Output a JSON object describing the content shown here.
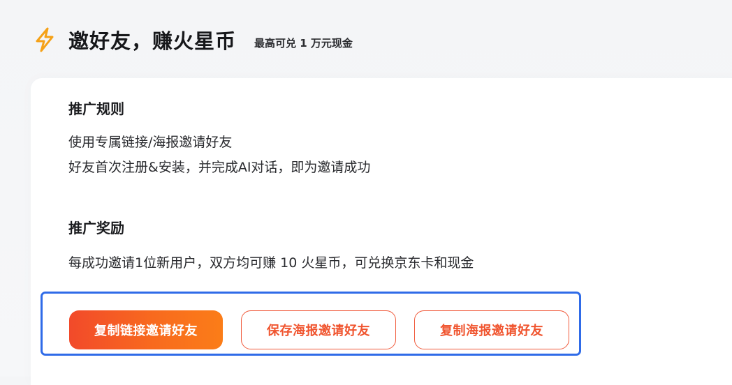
{
  "header": {
    "title": "邀好友，赚火星币",
    "subtitle": "最高可兑 1 万元现金",
    "icon": "lightning-bolt-icon",
    "accent": "#f6a11b"
  },
  "rules": {
    "title": "推广规则",
    "lines": [
      "使用专属链接/海报邀请好友",
      "好友首次注册&安装，并完成AI对话，即为邀请成功"
    ]
  },
  "rewards": {
    "title": "推广奖励",
    "lines": [
      "每成功邀请1位新用户，双方均可赚 10 火星币，可兑换京东卡和现金"
    ]
  },
  "actions": {
    "copy_link": "复制链接邀请好友",
    "save_poster": "保存海报邀请好友",
    "copy_poster": "复制海报邀请好友"
  },
  "colors": {
    "primary_gradient_start": "#f24a2a",
    "primary_gradient_end": "#fb7d18",
    "outline": "#f05a3b",
    "highlight_border": "#2f6be8"
  }
}
